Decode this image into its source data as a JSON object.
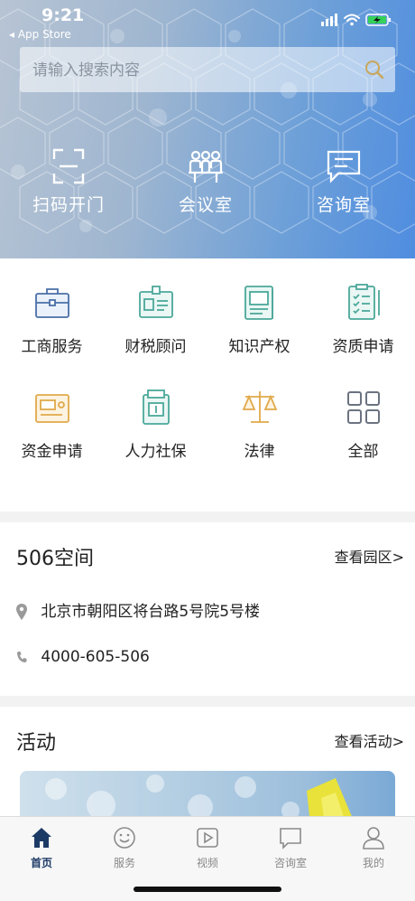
{
  "status_bar": {
    "time": "9:21",
    "back_app": "◂ App Store"
  },
  "search": {
    "placeholder": "请输入搜索内容"
  },
  "quick_actions": [
    {
      "label": "扫码开门",
      "icon": "scan-icon"
    },
    {
      "label": "会议室",
      "icon": "meeting-room-icon"
    },
    {
      "label": "咨询室",
      "icon": "consult-chat-icon"
    }
  ],
  "services": [
    {
      "label": "工商服务",
      "icon": "briefcase-icon"
    },
    {
      "label": "财税顾问",
      "icon": "id-card-icon"
    },
    {
      "label": "知识产权",
      "icon": "certificate-icon"
    },
    {
      "label": "资质申请",
      "icon": "checklist-clipboard-icon"
    },
    {
      "label": "资金申请",
      "icon": "funds-card-icon"
    },
    {
      "label": "人力社保",
      "icon": "document-icon"
    },
    {
      "label": "法律",
      "icon": "scales-icon"
    },
    {
      "label": "全部",
      "icon": "grid-icon"
    }
  ],
  "space": {
    "title": "506空间",
    "link": "查看园区>",
    "address": "北京市朝阳区将台路5号院5号楼",
    "phone": "4000-605-506"
  },
  "activity": {
    "title": "活动",
    "link": "查看活动>"
  },
  "tabs": [
    {
      "label": "首页",
      "icon": "home-icon",
      "active": true
    },
    {
      "label": "服务",
      "icon": "smile-icon",
      "active": false
    },
    {
      "label": "视频",
      "icon": "play-icon",
      "active": false
    },
    {
      "label": "咨询室",
      "icon": "chat-icon",
      "active": false
    },
    {
      "label": "我的",
      "icon": "user-icon",
      "active": false
    }
  ],
  "colors": {
    "hero_gradient_start": "#b7c4d4",
    "hero_gradient_end": "#4f8de0",
    "active_tab": "#1c3a66",
    "service_teal": "#4ba89a",
    "service_gold": "#e0a94a"
  }
}
